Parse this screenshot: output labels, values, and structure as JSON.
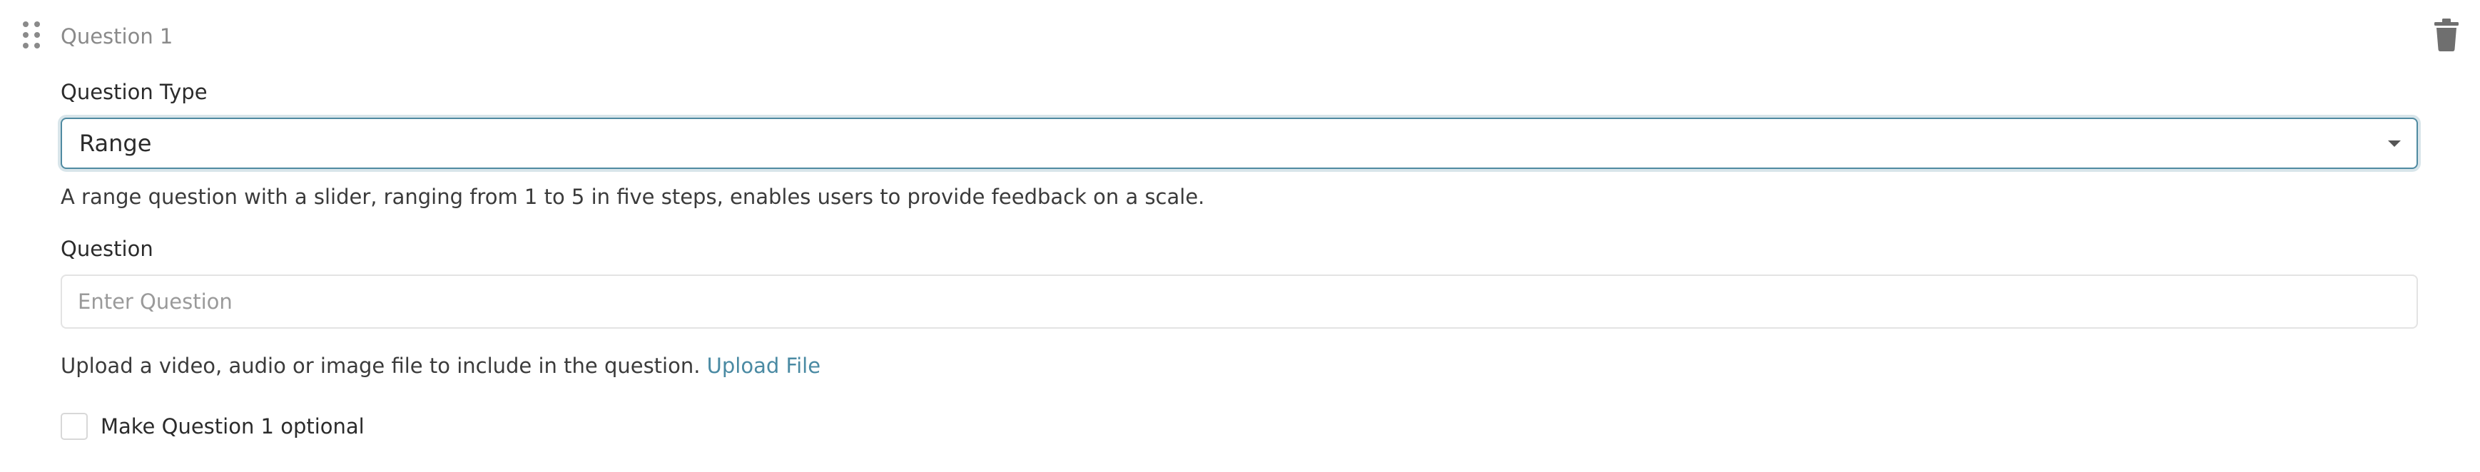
{
  "question_card": {
    "title": "Question 1",
    "drag_handle_icon": "drag-handle-icon",
    "delete_icon": "trash-icon"
  },
  "question_type": {
    "label": "Question Type",
    "selected": "Range",
    "help_text": "A range question with a slider, ranging from 1 to 5 in five steps, enables users to provide feedback on a scale."
  },
  "question": {
    "label": "Question",
    "placeholder": "Enter Question",
    "value": ""
  },
  "upload": {
    "text": "Upload a video, audio or image file to include in the question.",
    "link_label": "Upload File"
  },
  "optional": {
    "label": "Make Question 1 optional",
    "checked": false
  },
  "colors": {
    "accent": "#4f8aa1",
    "link": "#4a8aa3",
    "muted_text": "#8a8a8a",
    "border": "#e3e3e3"
  }
}
